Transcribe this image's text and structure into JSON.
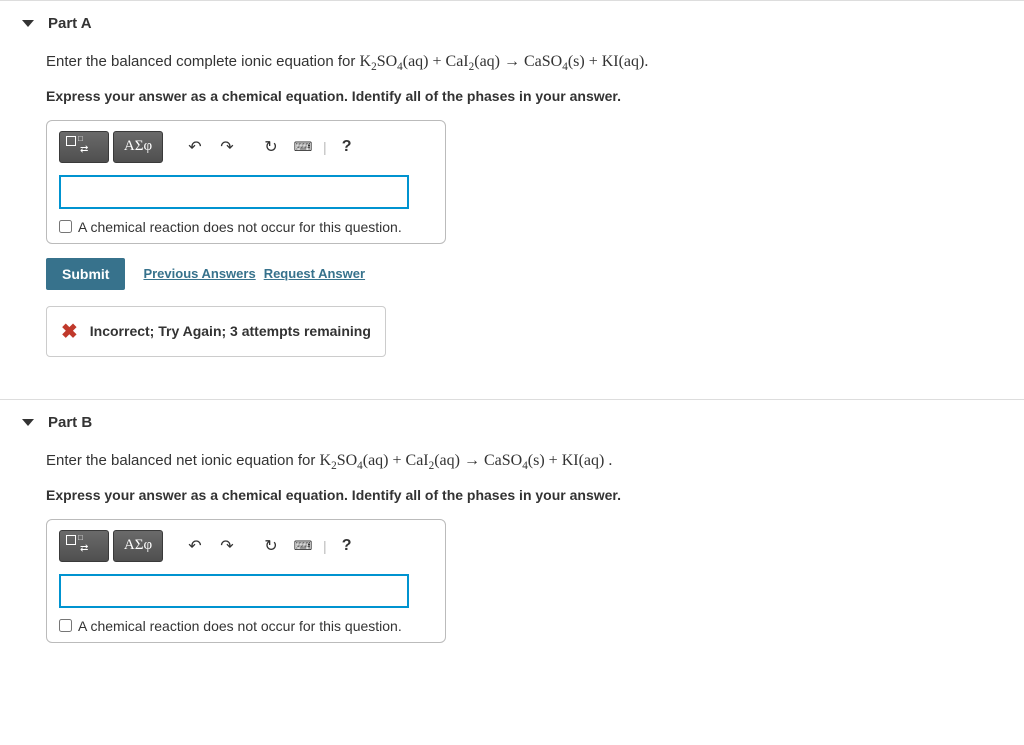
{
  "parts": {
    "a": {
      "title": "Part A",
      "prompt_prefix": "Enter the balanced complete ionic equation for ",
      "equation_html": "K<sub>2</sub>SO<sub>4</sub>(aq) + CaI<sub>2</sub>(aq) → CaSO<sub>4</sub>(s) + KI(aq).",
      "instruction": "Express your answer as a chemical equation. Identify all of the phases in your answer.",
      "no_reaction_label": "A chemical reaction does not occur for this question.",
      "submit_label": "Submit",
      "prev_answers_label": "Previous Answers",
      "request_answer_label": "Request Answer",
      "feedback": "Incorrect; Try Again; 3 attempts remaining"
    },
    "b": {
      "title": "Part B",
      "prompt_prefix": "Enter the balanced net ionic equation for ",
      "equation_html": "K<sub>2</sub>SO<sub>4</sub>(aq) + CaI<sub>2</sub>(aq) → CaSO<sub>4</sub>(s) + KI(aq) .",
      "instruction": "Express your answer as a chemical equation. Identify all of the phases in your answer.",
      "no_reaction_label": "A chemical reaction does not occur for this question."
    }
  },
  "toolbar": {
    "greek_label": "ΑΣφ",
    "help_label": "?"
  }
}
